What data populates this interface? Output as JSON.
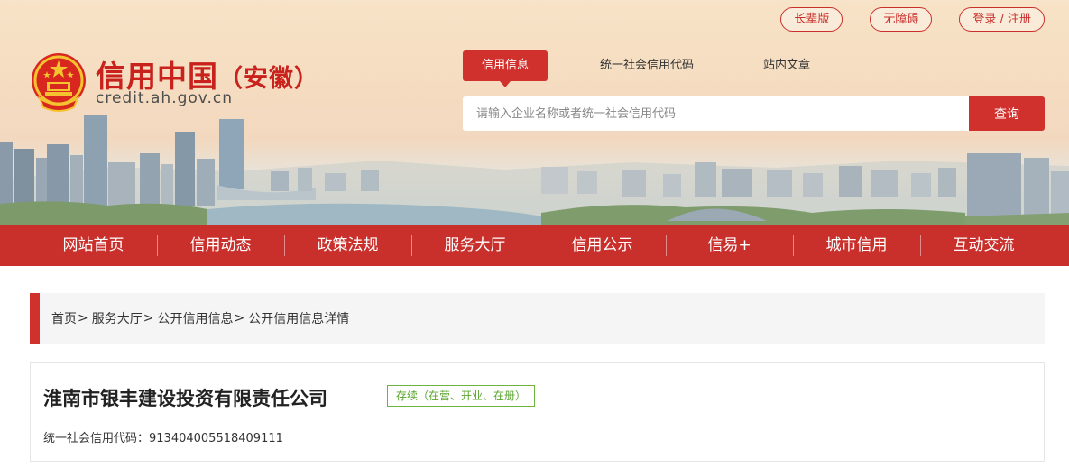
{
  "header": {
    "top_links": [
      "长辈版",
      "无障碍",
      "登录 / 注册"
    ],
    "site_title": "信用中国",
    "site_region": "（安徽）",
    "site_domain": "credit.ah.gov.cn",
    "search_tabs": [
      "信用信息",
      "统一社会信用代码",
      "站内文章"
    ],
    "active_tab": "信用信息",
    "search_placeholder": "请输入企业名称或者统一社会信用代码",
    "search_button": "查询"
  },
  "nav": {
    "items": [
      "网站首页",
      "信用动态",
      "政策法规",
      "服务大厅",
      "信用公示",
      "信易+",
      "城市信用",
      "互动交流"
    ]
  },
  "breadcrumb": {
    "items": [
      "首页",
      "服务大厅",
      "公开信用信息",
      "公开信用信息详情"
    ],
    "separator": ">"
  },
  "company": {
    "name": "淮南市银丰建设投资有限责任公司",
    "status": "存续（在营、开业、在册）",
    "credit_code_label": "统一社会信用代码：",
    "credit_code": "913404005518409111"
  },
  "colors": {
    "brand_red": "#c9302c",
    "status_green": "#5aa42e"
  },
  "icons": {
    "logo": "national-emblem-icon"
  }
}
